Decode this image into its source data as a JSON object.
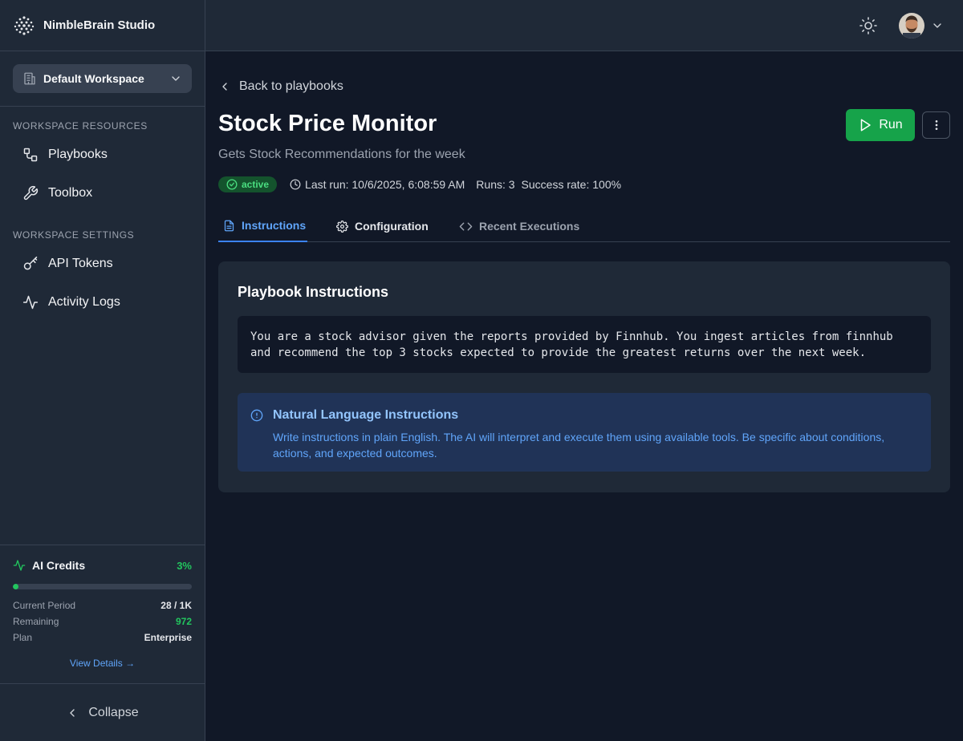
{
  "brand": {
    "name": "NimbleBrain Studio"
  },
  "workspace": {
    "selected": "Default Workspace"
  },
  "sidebar": {
    "resources_title": "WORKSPACE RESOURCES",
    "resources": [
      {
        "label": "Playbooks",
        "icon": "workflow-icon"
      },
      {
        "label": "Toolbox",
        "icon": "wrench-icon"
      }
    ],
    "settings_title": "WORKSPACE SETTINGS",
    "settings": [
      {
        "label": "API Tokens",
        "icon": "key-icon"
      },
      {
        "label": "Activity Logs",
        "icon": "activity-icon"
      }
    ],
    "collapse_label": "Collapse"
  },
  "credits": {
    "title": "AI Credits",
    "percent": "3%",
    "usage_fraction": 0.03,
    "rows": [
      {
        "label": "Current Period",
        "value": "28 / 1K"
      },
      {
        "label": "Remaining",
        "value": "972"
      },
      {
        "label": "Plan",
        "value": "Enterprise"
      }
    ],
    "view_details": "View Details →"
  },
  "page": {
    "back_label": "Back to playbooks",
    "title": "Stock Price Monitor",
    "subtitle": "Gets Stock Recommendations for the week",
    "run_label": "Run",
    "status": "active",
    "last_run": "Last run: 10/6/2025, 6:08:59 AM",
    "runs": "Runs: 3",
    "success_rate": "Success rate: 100%",
    "tabs": [
      {
        "label": "Instructions",
        "active": true
      },
      {
        "label": "Configuration",
        "active": false
      },
      {
        "label": "Recent Executions",
        "active": false
      }
    ],
    "card_title": "Playbook Instructions",
    "instructions": "You are a stock advisor given the reports provided by Finnhub. You ingest articles from finnhub and recommend the top 3 stocks expected to provide the greatest returns over the next week.",
    "info_title": "Natural Language Instructions",
    "info_text": "Write instructions in plain English. The AI will interpret and execute them using available tools. Be specific about conditions, actions, and expected outcomes."
  },
  "colors": {
    "accent": "#3b82f6",
    "success": "#22c55e",
    "run_button": "#16a34a"
  }
}
